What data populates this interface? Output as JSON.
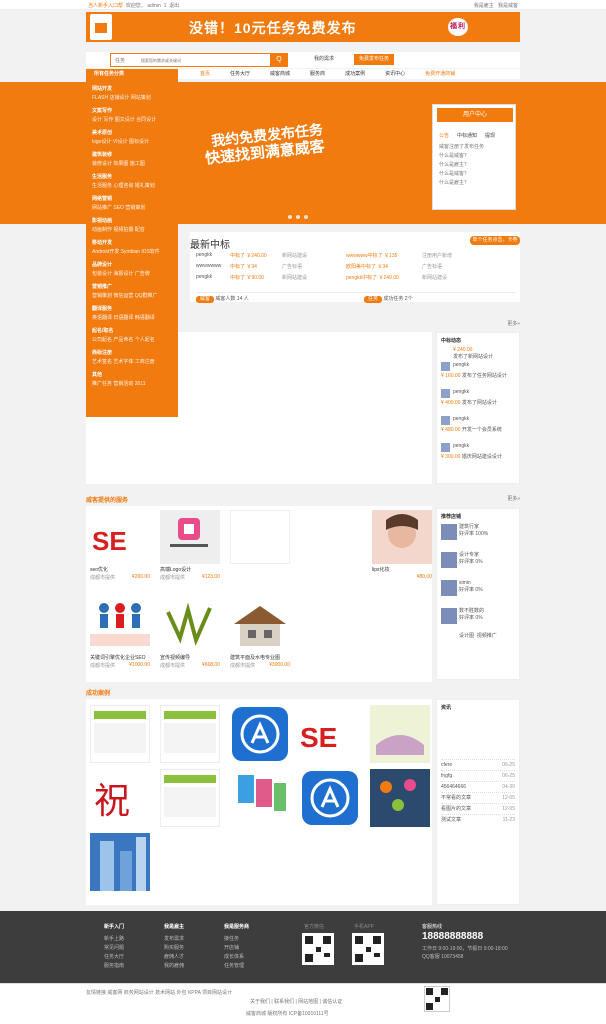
{
  "topbar": {
    "greeting": "当人新手入口帮",
    "welcome": "欢迎您，",
    "user": "admin",
    "msg": "1",
    "logout": "退出",
    "right1": "我是雇主",
    "right2": "我是威客"
  },
  "banner": {
    "text": "没错！10元任务免费发布",
    "badge": "福利"
  },
  "search": {
    "select": "任务",
    "placeholder": "搜索您的需求或关键词",
    "button": "Q",
    "pub_task": "我的需求",
    "pub_btn": "免费发布任务"
  },
  "nav": {
    "category": "所有任务分类",
    "items": [
      "首页",
      "任务大厅",
      "威客商城",
      "服务商",
      "成功案例",
      "资讯中心",
      "免费开通商铺"
    ]
  },
  "sidemenu": [
    {
      "title": "网站开发",
      "items": "FLASH  店铺设计  网站策划"
    },
    {
      "title": "文案写作",
      "items": "设计 写作  图文设计  合同设计"
    },
    {
      "title": "美术原创",
      "items": "logo设计  VI设计  图标设计"
    },
    {
      "title": "建筑装修",
      "items": "装修设计  效果图  施工图"
    },
    {
      "title": "生活服务",
      "items": "生活服务  心理咨询  婚礼策划"
    },
    {
      "title": "网络营销",
      "items": "网站推广  SEO  营销策划"
    },
    {
      "title": "影视动画",
      "items": "动画制作  视频拍摄  配音"
    },
    {
      "title": "移动开发",
      "items": "Android开发  Symbian  iOS软件"
    },
    {
      "title": "品牌设计",
      "items": "包装设计  海报设计  广告牌"
    },
    {
      "title": "营销推广",
      "items": "营销策划  微信运营  QQ群推广"
    },
    {
      "title": "翻译服务",
      "items": "英语翻译  日语翻译  韩语翻译"
    },
    {
      "title": "起名/取名",
      "items": "公司起名  产品命名  个人起名"
    },
    {
      "title": "商标注册",
      "items": "艺术签名  艺术字体  工商注册"
    },
    {
      "title": "其他",
      "items": "推广任务  营销活动  2011"
    }
  ],
  "hero": {
    "line1": "我约免费发布任务",
    "line2": "快速找到满意威客"
  },
  "userbox": {
    "title": "用户中心",
    "tabs": [
      "公告",
      "中标通知",
      "提现"
    ],
    "items": [
      "威客注册了发布任务",
      "什么是威客？",
      "什么是雇主？",
      "什么是威客？",
      "什么是雇主？"
    ]
  },
  "winners": {
    "title": "最新中标",
    "more": "单个任务点击，卡券",
    "rows": [
      {
        "left": "pengkk",
        "mid": "中标了 ￥240.00",
        "task": "新网站建设",
        "right": "wwwwww中标了 ￥135",
        "rtask": "注册用户新增"
      },
      {
        "left": "wwwwwww",
        "mid": "中标了 ￥34",
        "task": "广告标语",
        "right": "欧阳美中标了 ￥34",
        "rtask": "广告标语"
      },
      {
        "left": "pengkk",
        "mid": "中标了 ￥90.00",
        "task": "新网站建设",
        "right": "pengkk中标了 ￥240.00",
        "rtask": "新网站建设"
      }
    ],
    "bot_left_pill": "威客",
    "bot_left": "威客人数 14 人",
    "bot_right_pill": "任务",
    "bot_right": "成功任务 2个"
  },
  "sections": {
    "more": "更多»",
    "services_title": "威客提供的服务",
    "cases_title": "成功案例"
  },
  "dynamic": {
    "title": "中标动态",
    "items": [
      {
        "who": "",
        "price": "¥ 240.00",
        "task": "发布了新网站设计"
      },
      {
        "who": "pengkk",
        "price": "¥ 160.00",
        "task": "发布了任务网站设计"
      },
      {
        "who": "pengkk",
        "price": "¥ 400.00",
        "task": "发布了网站设计"
      },
      {
        "who": "pengkk",
        "price": "¥ 480.00",
        "task": "开发一个会员系统"
      },
      {
        "who": "pengkk",
        "price": "¥ 300.00",
        "task": "婚庆网站建设设计"
      }
    ]
  },
  "services": [
    {
      "name": "seo优化",
      "sub": "成都市提供",
      "price": "¥200.00"
    },
    {
      "name": "高端Logo设计",
      "sub": "成都市提供",
      "price": "¥123.00"
    },
    {
      "name": "",
      "sub": "",
      "price": ""
    },
    {
      "name": "lips化妆",
      "sub": "",
      "price": "¥80.00"
    },
    {
      "name": "关键词引擎优化企业SEO",
      "sub": "成都市提供",
      "price": "¥1000.00"
    },
    {
      "name": "宣传视频编导",
      "sub": "成都市提供",
      "price": "¥668.00"
    },
    {
      "name": "建筑平面及水电专业图",
      "sub": "成都市提供",
      "price": "¥3000.00"
    }
  ],
  "shops": {
    "title": "推荐店铺",
    "items": [
      {
        "name": "建筑行家",
        "rate": "好评率 100%"
      },
      {
        "name": "设计专家",
        "rate": "好评率 0%"
      },
      {
        "name": "simin",
        "rate": "好评率 0%"
      },
      {
        "name": "数不胜数的",
        "rate": "好评率 0%"
      }
    ],
    "tag1": "设计图",
    "tag2": "视频推广"
  },
  "news": {
    "title": "资讯",
    "items": [
      {
        "t": "cfere",
        "d": "06-25"
      },
      {
        "t": "fngfg",
        "d": "06-25"
      },
      {
        "t": "456464666",
        "d": "04-30"
      },
      {
        "t": "不常看的文章",
        "d": "12-05"
      },
      {
        "t": "看图片的文章",
        "d": "12-05"
      },
      {
        "t": "测试文章",
        "d": "11-23"
      }
    ]
  },
  "footer": {
    "cols": [
      {
        "title": "新手入门",
        "items": [
          "新手上路",
          "常见问题",
          "任务大厅",
          "服务指南"
        ]
      },
      {
        "title": "我是雇主",
        "items": [
          "发布需求",
          "购买服务",
          "雇佣人才",
          "我的雇佣"
        ]
      },
      {
        "title": "我是服务商",
        "items": [
          "接任务",
          "开店铺",
          "成长体系",
          "任务管理"
        ]
      }
    ],
    "qr1": "官方微信",
    "qr2": "手机APP",
    "tel_label": "客服热线",
    "tel": "18888888888",
    "tinfo1": "工作日 9:00-19:00，节假日 9:00-18:00",
    "tinfo2": "QQ客服 10073458"
  },
  "copy": {
    "links": "友情链接   威客网   商务网站设计   技术网站   外包   KPPA   项目网站设计",
    "line2": "关于我们 | 联系我们 | 网站地图 | 诚信认证",
    "line3": "威客商城 版权所有 ICP备10010111号"
  }
}
